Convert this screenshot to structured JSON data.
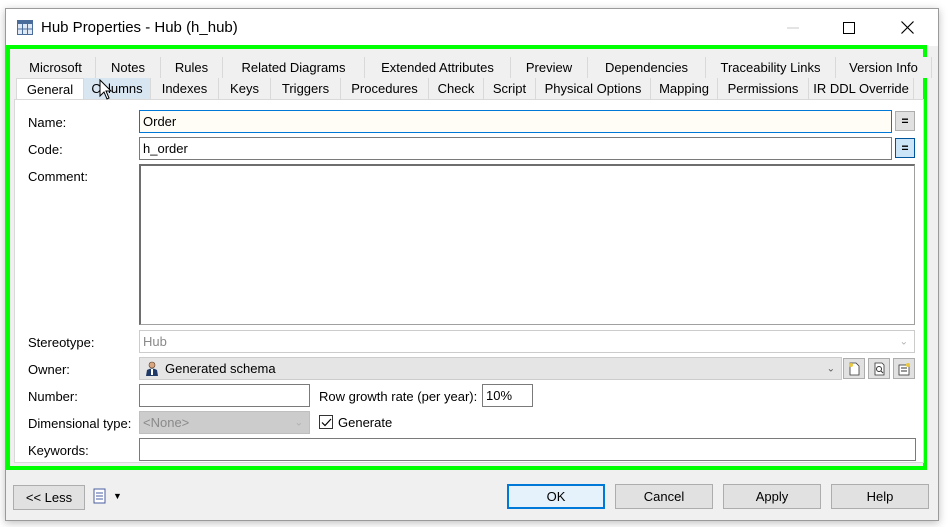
{
  "window": {
    "title": "Hub Properties - Hub (h_hub)",
    "controls": {
      "minimize": "minimize",
      "maximize": "maximize",
      "close": "close"
    }
  },
  "tabs": {
    "back_row": [
      "Microsoft",
      "Notes",
      "Rules",
      "Related Diagrams",
      "Extended Attributes",
      "Preview",
      "Dependencies",
      "Traceability Links",
      "Version Info"
    ],
    "front_row": [
      "General",
      "Columns",
      "Indexes",
      "Keys",
      "Triggers",
      "Procedures",
      "Check",
      "Script",
      "Physical Options",
      "Mapping",
      "Permissions",
      "IR DDL Override"
    ],
    "active": "General",
    "hovered": "Columns"
  },
  "form": {
    "name": {
      "label": "Name:",
      "value": "Order"
    },
    "code": {
      "label": "Code:",
      "value": "h_order"
    },
    "equals_button": "=",
    "comment": {
      "label": "Comment:",
      "value": ""
    },
    "stereotype": {
      "label": "Stereotype:",
      "value": "Hub"
    },
    "owner": {
      "label": "Owner:",
      "value": "Generated schema"
    },
    "number": {
      "label": "Number:",
      "value": ""
    },
    "row_growth": {
      "label": "Row growth rate (per year):",
      "value": "10%"
    },
    "dimensional_type": {
      "label": "Dimensional type:",
      "value": "<None>"
    },
    "generate": {
      "label": "Generate",
      "checked": true
    },
    "keywords": {
      "label": "Keywords:",
      "value": ""
    }
  },
  "footer": {
    "less_button": "<< Less",
    "ok": "OK",
    "cancel": "Cancel",
    "apply": "Apply",
    "help": "Help"
  },
  "colors": {
    "highlight": "#00ff00",
    "focus": "#0078d7"
  }
}
